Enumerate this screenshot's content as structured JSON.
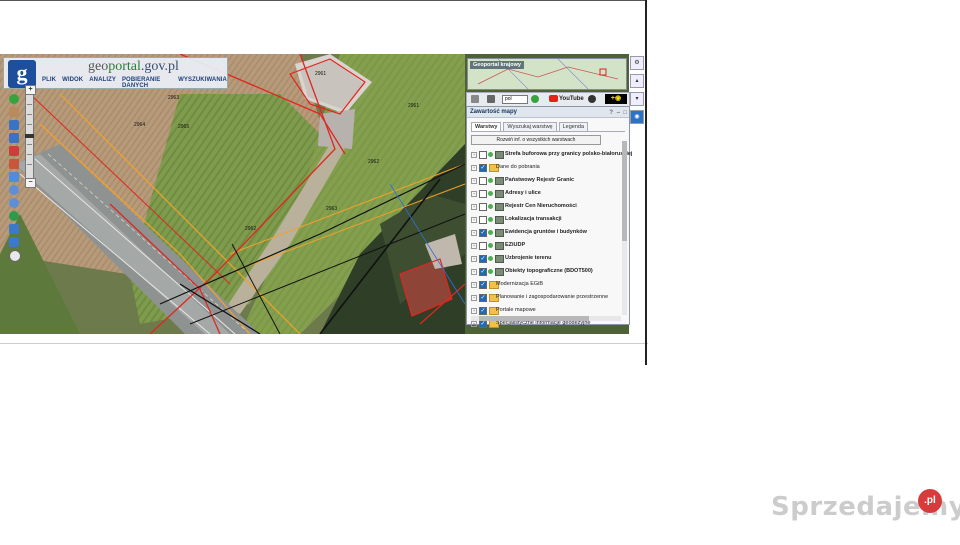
{
  "brand": {
    "part1": "geo",
    "part2": "portal",
    "part3": ".gov.pl"
  },
  "menu": [
    "PLIK",
    "WIDOK",
    "ANALIZY",
    "POBIERANIE DANYCH",
    "WYSZUKIWANIA"
  ],
  "map_labels": [
    "2963",
    "2964",
    "2965",
    "2961",
    "2962",
    "2963",
    "2961",
    "2962"
  ],
  "overview": {
    "title": "Geoportal krajowy"
  },
  "panel_tools": {
    "language": "pol",
    "youtube": "YouTube"
  },
  "layers_panel": {
    "title": "Zawartość mapy",
    "tabs": [
      "Warstwy",
      "Wyszukaj warstwę",
      "Legenda"
    ],
    "expand_label": "Rozwiń inf. o wszystkich warstwach",
    "items": [
      {
        "label": "Strefa buforowa przy granicy polsko-białoruskiej",
        "checked": false,
        "bold": true,
        "type": "layer",
        "dot": "#4caf50"
      },
      {
        "label": "Dane do pobrania",
        "checked": true,
        "bold": false,
        "type": "folder"
      },
      {
        "label": "Państwowy Rejestr Granic",
        "checked": false,
        "bold": true,
        "type": "layer",
        "dot": "#4caf50"
      },
      {
        "label": "Adresy i ulice",
        "checked": false,
        "bold": true,
        "type": "layer",
        "dot": "#4caf50"
      },
      {
        "label": "Rejestr Cen Nieruchomości",
        "checked": false,
        "bold": true,
        "type": "layer",
        "dot": "#4caf50"
      },
      {
        "label": "Lokalizacja transakcji",
        "checked": false,
        "bold": true,
        "type": "layer",
        "dot": "#4caf50"
      },
      {
        "label": "Ewidencja gruntów i budynków",
        "checked": true,
        "bold": true,
        "type": "layer",
        "dot": "#4caf50"
      },
      {
        "label": "EZiUDP",
        "checked": false,
        "bold": true,
        "type": "layer",
        "dot": "#4caf50"
      },
      {
        "label": "Uzbrojenie terenu",
        "checked": true,
        "bold": true,
        "type": "layer",
        "dot": "#4caf50"
      },
      {
        "label": "Obiekty topograficzne (BDOT500)",
        "checked": true,
        "bold": true,
        "type": "layer",
        "dot": "#4caf50"
      },
      {
        "label": "Modernizacja EGiB",
        "checked": true,
        "bold": false,
        "type": "folder"
      },
      {
        "label": "Planowanie i zagospodarowanie przestrzenne",
        "checked": true,
        "bold": false,
        "type": "folder"
      },
      {
        "label": "Portale mapowe",
        "checked": true,
        "bold": false,
        "type": "folder"
      },
      {
        "label": "Specjalistyczne informacje geodezyjne",
        "checked": true,
        "bold": false,
        "type": "folder"
      }
    ]
  },
  "watermark": {
    "text": "Sprzedajemy",
    "badge": ".pl"
  },
  "colors": {
    "parcel_line": "#e0261f",
    "buffer_line": "#f2a12b",
    "boundary_line": "#111111",
    "field": "#7e9a4c"
  }
}
